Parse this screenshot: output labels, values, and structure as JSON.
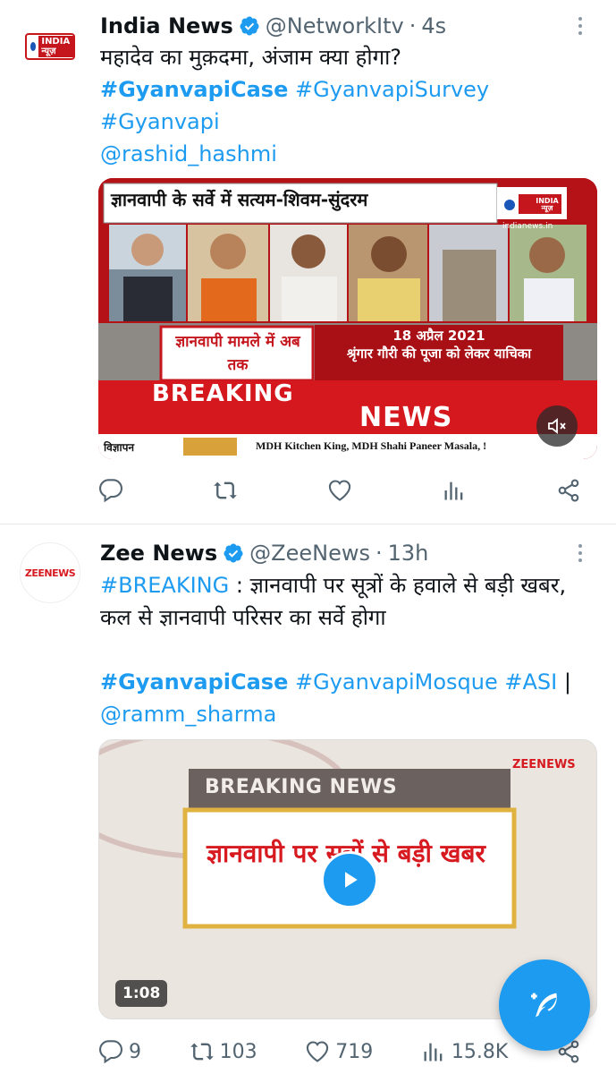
{
  "tweets": [
    {
      "author": "India News",
      "handle": "@NetworkItv",
      "time": "4s",
      "line1": "महादेव का मुक़दमा, अंजाम क्या होगा?",
      "hashtag1": "#GyanvapiCase",
      "hashtag2": "#GyanvapiSurvey",
      "hashtag3": "#Gyanvapi",
      "mention": "@rashid_hashmi",
      "avatar_text": "INDIA न्यूज़",
      "media": {
        "headline": "ज्ञानवापी के सर्वे में सत्यम-शिवम-सुंदरम",
        "logo": "INDIA न्यूज़",
        "site": "indianews.in",
        "box_left": "ज्ञानवापी मामले में अब तक",
        "box_right_date": "18 अप्रैल 2021",
        "box_right_text": "श्रृंगार गौरी की पूजा को लेकर याचिका",
        "breaking": "BREAKING",
        "news": "NEWS",
        "ticker_label": "विज्ञापन",
        "ticker": "MDH Kitchen King, MDH Shahi Paneer Masala, !"
      }
    },
    {
      "author": "Zee News",
      "handle": "@ZeeNews",
      "time": "13h",
      "breaking_tag": "#BREAKING",
      "line1": " : ज्ञानवापी पर सूत्रों के हवाले से बड़ी खबर,",
      "line2": "कल से ज्ञानवापी परिसर का सर्वे होगा",
      "hashtag1": "#GyanvapiCase",
      "hashtag2": "#GyanvapiMosque",
      "hashtag3": "#ASI",
      "separator": " |",
      "mention": "@ramm_sharma",
      "avatar_text": "ZEENEWS",
      "media": {
        "logo": "ZEENEWS",
        "banner": "BREAKING NEWS",
        "headline": "ज्ञानवापी पर सूत्रों से बड़ी खबर",
        "duration": "1:08"
      },
      "stats": {
        "replies": "9",
        "retweets": "103",
        "likes": "719",
        "views": "15.8K"
      }
    }
  ],
  "colors": {
    "accent": "#1d9bf0",
    "text": "#0f1419",
    "muted": "#536471",
    "breaking_red": "#c4161c"
  },
  "icons": [
    "reply-icon",
    "retweet-icon",
    "like-icon",
    "views-icon",
    "share-icon",
    "verified-badge-icon",
    "more-icon",
    "mute-icon",
    "play-icon",
    "compose-icon"
  ]
}
